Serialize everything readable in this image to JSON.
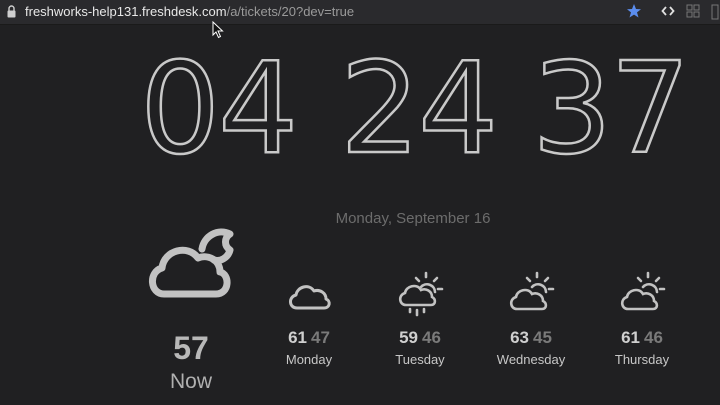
{
  "browser": {
    "url_host": "freshworks-help131.freshdesk.com",
    "url_path": "/a/tickets/20?dev=true"
  },
  "clock": {
    "hours": "04",
    "minutes": "24",
    "seconds": "37"
  },
  "date": "Monday, September 16",
  "current": {
    "temp": "57",
    "label": "Now",
    "icon": "partly-cloudy-night-icon"
  },
  "forecast": [
    {
      "day": "Monday",
      "high": "61",
      "low": "47",
      "icon": "cloud-icon"
    },
    {
      "day": "Tuesday",
      "high": "59",
      "low": "46",
      "icon": "sun-cloud-rain-icon"
    },
    {
      "day": "Wednesday",
      "high": "63",
      "low": "45",
      "icon": "partly-sunny-icon"
    },
    {
      "day": "Thursday",
      "high": "61",
      "low": "46",
      "icon": "partly-sunny-icon"
    }
  ],
  "colors": {
    "background": "#202022",
    "accent_star": "#5b8dee",
    "text": "#cfcfcf",
    "muted": "#7a7a7a"
  }
}
